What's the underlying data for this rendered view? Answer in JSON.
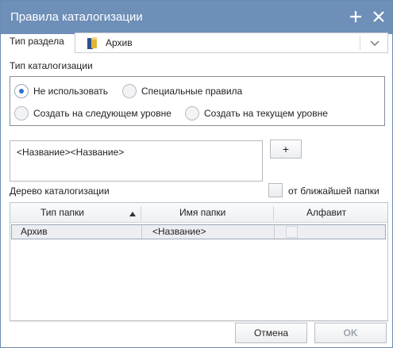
{
  "dialog": {
    "title": "Правила каталогизации",
    "plus_icon": "plus-icon",
    "close_icon": "close-icon"
  },
  "section_type": {
    "label": "Тип раздела",
    "value": "Архив",
    "icon": "archive-icon"
  },
  "catalog_type": {
    "label": "Тип каталогизации",
    "options": [
      {
        "label": "Не использовать",
        "selected": true
      },
      {
        "label": "Специальные правила",
        "selected": false
      },
      {
        "label": "Создать на следующем уровне",
        "selected": false
      },
      {
        "label": "Создать на текущем уровне",
        "selected": false
      }
    ]
  },
  "template": {
    "value": "<Название><Название>",
    "add_label": "+"
  },
  "tree": {
    "label": "Дерево каталогизации",
    "nearest_folder_label": "от ближайшей папки",
    "nearest_folder_checked": false,
    "columns": [
      "Тип папки",
      "Имя папки",
      "Алфавит"
    ],
    "rows": [
      {
        "type": "Архив",
        "name": "<Название>",
        "alphabet": false
      }
    ]
  },
  "footer": {
    "cancel_label": "Отмена",
    "ok_label": "OK"
  },
  "colors": {
    "titlebar": "#6d8fb8",
    "radio_selected": "#2f6fd1"
  }
}
